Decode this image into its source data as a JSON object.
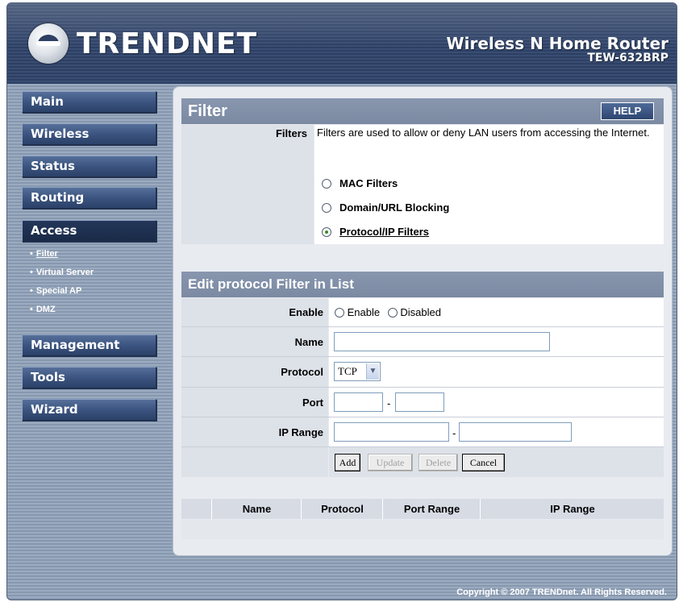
{
  "header": {
    "brand": "TRENDNET",
    "product_title": "Wireless N Home Router",
    "model": "TEW-632BRP"
  },
  "sidebar": {
    "menu": [
      {
        "label": "Main"
      },
      {
        "label": "Wireless"
      },
      {
        "label": "Status"
      },
      {
        "label": "Routing"
      },
      {
        "label": "Access"
      },
      {
        "label": "Management"
      },
      {
        "label": "Tools"
      },
      {
        "label": "Wizard"
      }
    ],
    "access_submenu": [
      {
        "label": "Filter",
        "bullet": "•"
      },
      {
        "label": "Virtual Server",
        "bullet": "•"
      },
      {
        "label": "Special AP",
        "bullet": "•"
      },
      {
        "label": "DMZ",
        "bullet": "•"
      }
    ]
  },
  "filter_section": {
    "title": "Filter",
    "help_label": "HELP",
    "filters_label": "Filters",
    "description": "Filters are used to allow or deny LAN users from accessing the Internet.",
    "options": [
      {
        "label": "MAC Filters",
        "selected": false
      },
      {
        "label": "Domain/URL Blocking",
        "selected": false
      },
      {
        "label": "Protocol/IP Filters",
        "selected": true
      }
    ]
  },
  "edit_section": {
    "title": "Edit protocol Filter in List",
    "enable_label": "Enable",
    "enable_option": "Enable",
    "disabled_option": "Disabled",
    "name_label": "Name",
    "name_value": "",
    "protocol_label": "Protocol",
    "protocol_value": "TCP",
    "port_label": "Port",
    "port_separator": "-",
    "port_start": "",
    "port_end": "",
    "ip_range_label": "IP Range",
    "ip_separator": "-",
    "ip_start": "",
    "ip_end": "",
    "buttons": {
      "add": "Add",
      "update": "Update",
      "delete": "Delete",
      "cancel": "Cancel"
    }
  },
  "list": {
    "columns": [
      "Name",
      "Protocol",
      "Port Range",
      "IP Range"
    ],
    "rows": []
  },
  "footer": {
    "copyright": "Copyright © 2007 TRENDnet. All Rights Reserved."
  },
  "colors": {
    "header_bg": "#2d4064",
    "section_header": "#8896ae",
    "menu_button": "#3b5480"
  }
}
